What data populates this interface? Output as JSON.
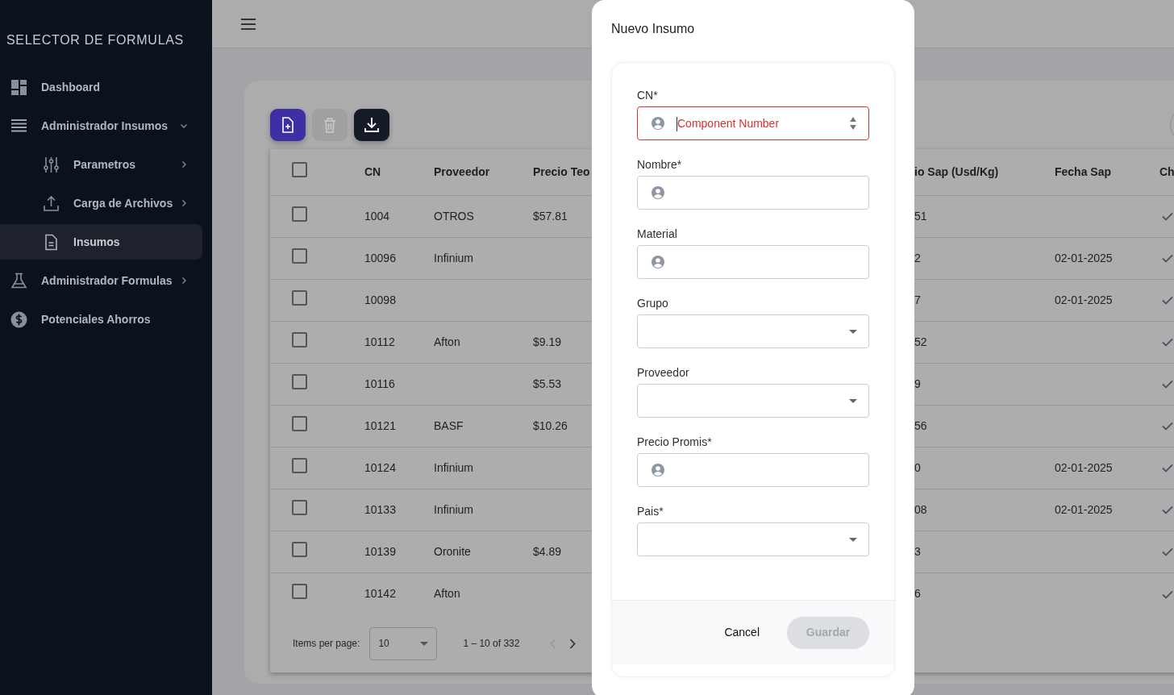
{
  "sidebar": {
    "title": "SELECTOR DE FORMULAS",
    "items": [
      {
        "label": "Dashboard",
        "kind": "link",
        "selected": false
      },
      {
        "label": "Administrador Insumos",
        "kind": "group",
        "expanded": true,
        "selected": false,
        "children": [
          {
            "label": "Parametros",
            "kind": "group",
            "expanded": false,
            "selected": false
          },
          {
            "label": "Carga de Archivos",
            "kind": "group",
            "expanded": false,
            "selected": false
          },
          {
            "label": "Insumos",
            "kind": "link",
            "selected": true
          }
        ]
      },
      {
        "label": "Administrador Formulas",
        "kind": "group",
        "expanded": false,
        "selected": false
      },
      {
        "label": "Potenciales Ahorros",
        "kind": "link",
        "selected": false
      }
    ]
  },
  "toolbar": [
    {
      "kind": "add",
      "disabled": false
    },
    {
      "kind": "delete",
      "disabled": true
    },
    {
      "kind": "download",
      "disabled": false
    }
  ],
  "table": {
    "all_selected": false,
    "columns": [
      "CN",
      "Proveedor",
      "Precio Teo",
      "io Sap (Usd/Kg)",
      "Fecha Sap",
      "Ch"
    ],
    "rows": [
      {
        "selected": false,
        "cn": "1004",
        "proveedor": "OTROS",
        "precio_teo": "$57.81",
        "column_sap": "51",
        "fecha_sap": "",
        "ch": true
      },
      {
        "selected": false,
        "cn": "10096",
        "proveedor": "Infinium",
        "precio_teo": "",
        "column_sap": "2",
        "fecha_sap": "02-01-2025",
        "ch": true
      },
      {
        "selected": false,
        "cn": "10098",
        "proveedor": "",
        "precio_teo": "",
        "column_sap": "7",
        "fecha_sap": "02-01-2025",
        "ch": true
      },
      {
        "selected": false,
        "cn": "10112",
        "proveedor": "Afton",
        "precio_teo": "$9.19",
        "column_sap": "52",
        "fecha_sap": "",
        "ch": true
      },
      {
        "selected": false,
        "cn": "10116",
        "proveedor": "",
        "precio_teo": "$5.53",
        "column_sap": "9",
        "fecha_sap": "",
        "ch": true
      },
      {
        "selected": false,
        "cn": "10121",
        "proveedor": "BASF",
        "precio_teo": "$10.26",
        "column_sap": "56",
        "fecha_sap": "",
        "ch": true
      },
      {
        "selected": false,
        "cn": "10124",
        "proveedor": "Infinium",
        "precio_teo": "",
        "column_sap": "0",
        "fecha_sap": "02-01-2025",
        "ch": true
      },
      {
        "selected": false,
        "cn": "10133",
        "proveedor": "Infinium",
        "precio_teo": "",
        "column_sap": "08",
        "fecha_sap": "02-01-2025",
        "ch": true
      },
      {
        "selected": false,
        "cn": "10139",
        "proveedor": "Oronite",
        "precio_teo": "$4.89",
        "column_sap": "3",
        "fecha_sap": "",
        "ch": true
      },
      {
        "selected": false,
        "cn": "10142",
        "proveedor": "Afton",
        "precio_teo": "",
        "column_sap": "6",
        "fecha_sap": "",
        "ch": true
      }
    ]
  },
  "paginator": {
    "label": "Items per page:",
    "page_size": "10",
    "range": "1 – 10 of 332",
    "prev_disabled": true,
    "next_disabled": false
  },
  "dialog": {
    "title": "Nuevo Insumo",
    "fields": [
      {
        "label": "CN*",
        "kind": "number",
        "placeholder": "Component Number",
        "invalid": true,
        "focused": true
      },
      {
        "label": "Nombre*",
        "kind": "text",
        "invalid": false,
        "focused": false
      },
      {
        "label": "Material",
        "kind": "text",
        "invalid": false,
        "focused": false
      },
      {
        "label": "Grupo",
        "kind": "select",
        "invalid": false,
        "focused": false
      },
      {
        "label": "Proveedor",
        "kind": "select",
        "invalid": false,
        "focused": false
      },
      {
        "label": "Precio Promis*",
        "kind": "text",
        "invalid": false,
        "focused": false
      },
      {
        "label": "Pais*",
        "kind": "select",
        "invalid": false,
        "focused": false
      }
    ],
    "buttons": [
      {
        "label": "Cancel",
        "kind": "text"
      },
      {
        "label": "Guardar",
        "kind": "filled",
        "disabled": true
      }
    ]
  }
}
